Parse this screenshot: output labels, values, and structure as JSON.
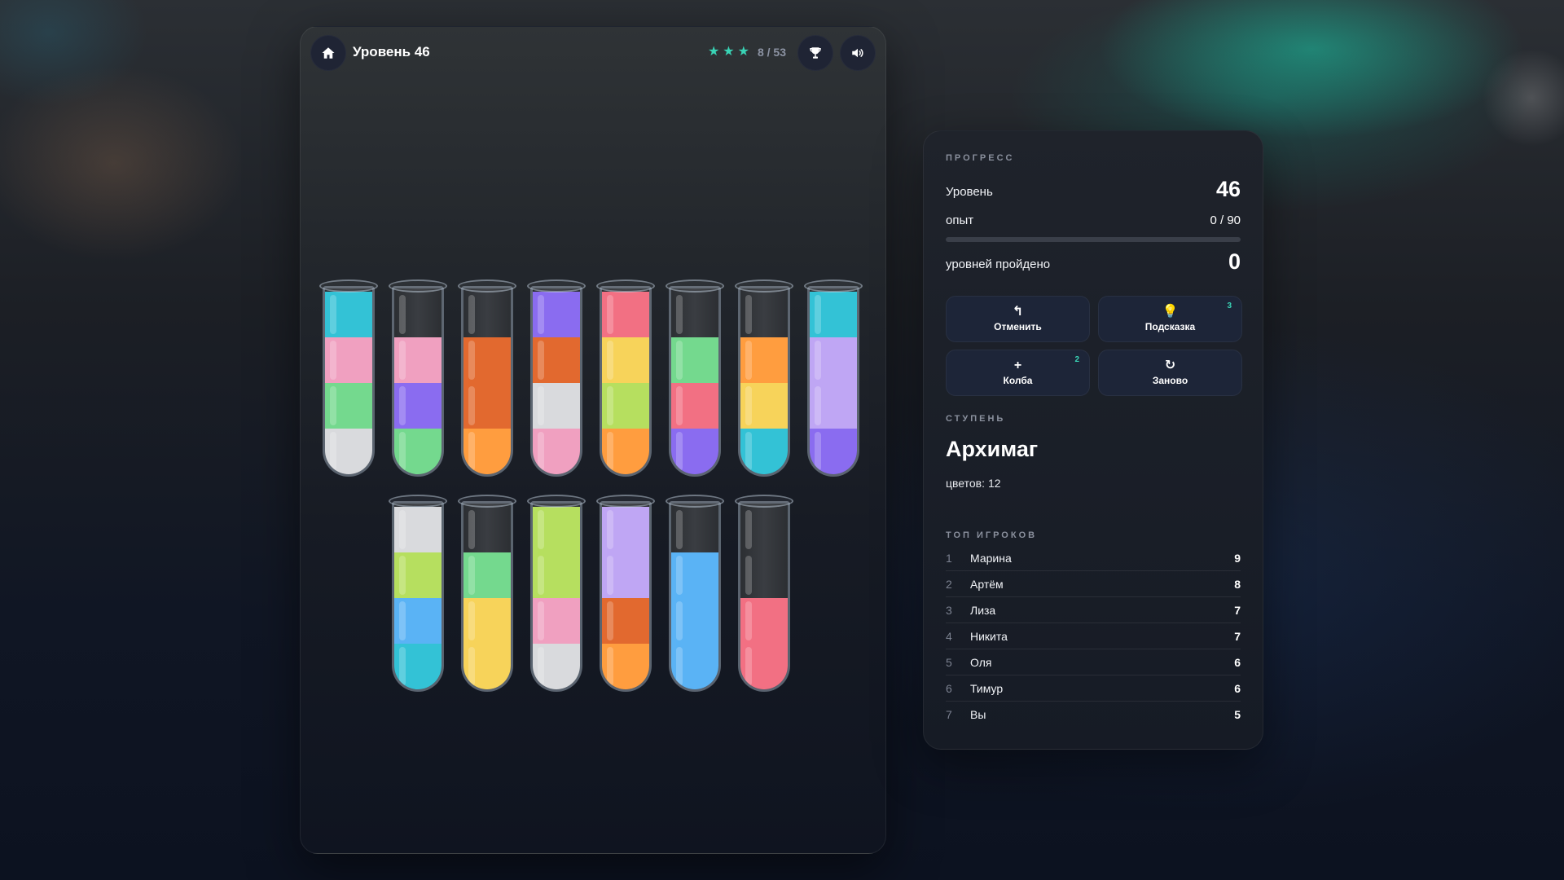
{
  "header": {
    "level_title": "Уровень 46",
    "moves": "8 / 53",
    "stars": 3,
    "star_color": "#39d3b5"
  },
  "colors": {
    "empty": "#35383d",
    "cyan": "#33c2d6",
    "pink": "#f0a0c0",
    "green": "#74d98e",
    "white": "#d9dadd",
    "purple": "#8a6cf0",
    "orange_dark": "#e2692f",
    "orange": "#ff9d3f",
    "red": "#f27083",
    "yellow": "#f7d35a",
    "lime": "#b6df5f",
    "lavender": "#bfa6f4",
    "blue": "#5ab3f5"
  },
  "tubes": [
    [
      "cyan",
      "pink",
      "green",
      "white"
    ],
    [
      "empty",
      "pink",
      "purple",
      "green"
    ],
    [
      "empty",
      "orange_dark",
      "orange_dark",
      "orange"
    ],
    [
      "purple",
      "orange_dark",
      "white",
      "pink"
    ],
    [
      "red",
      "yellow",
      "lime",
      "orange"
    ],
    [
      "empty",
      "green",
      "red",
      "purple"
    ],
    [
      "empty",
      "orange",
      "yellow",
      "cyan"
    ],
    [
      "cyan",
      "lavender",
      "lavender",
      "purple"
    ],
    [
      "white",
      "lime",
      "blue",
      "cyan"
    ],
    [
      "empty",
      "green",
      "yellow",
      "yellow"
    ],
    [
      "lime",
      "lime",
      "pink",
      "white"
    ],
    [
      "lavender",
      "lavender",
      "orange_dark",
      "orange"
    ],
    [
      "empty",
      "blue",
      "blue",
      "blue"
    ],
    [
      "empty",
      "empty",
      "red",
      "red"
    ]
  ],
  "progress": {
    "title": "ПРОГРЕСС",
    "level_label": "Уровень",
    "level_value": "46",
    "xp_label": "опыт",
    "xp_value": "0 / 90",
    "xp_fraction": 0,
    "completed_label": "уровней пройдено",
    "completed_value": "0"
  },
  "actions": {
    "undo": {
      "label": "Отменить",
      "icon": "↰"
    },
    "hint": {
      "label": "Подсказка",
      "icon": "💡",
      "badge": "3"
    },
    "flask": {
      "label": "Колба",
      "icon": "+",
      "badge": "2"
    },
    "restart": {
      "label": "Заново",
      "icon": "↻"
    }
  },
  "rank": {
    "title": "СТУПЕНЬ",
    "name": "Архимаг",
    "colors_label": "цветов:",
    "colors_value": "12"
  },
  "leaderboard": {
    "title": "ТОП ИГРОКОВ",
    "rows": [
      {
        "pos": "1",
        "name": "Марина",
        "score": "9"
      },
      {
        "pos": "2",
        "name": "Артём",
        "score": "8"
      },
      {
        "pos": "3",
        "name": "Лиза",
        "score": "7"
      },
      {
        "pos": "4",
        "name": "Никита",
        "score": "7"
      },
      {
        "pos": "5",
        "name": "Оля",
        "score": "6"
      },
      {
        "pos": "6",
        "name": "Тимур",
        "score": "6"
      },
      {
        "pos": "7",
        "name": "Вы",
        "score": "5"
      }
    ]
  }
}
